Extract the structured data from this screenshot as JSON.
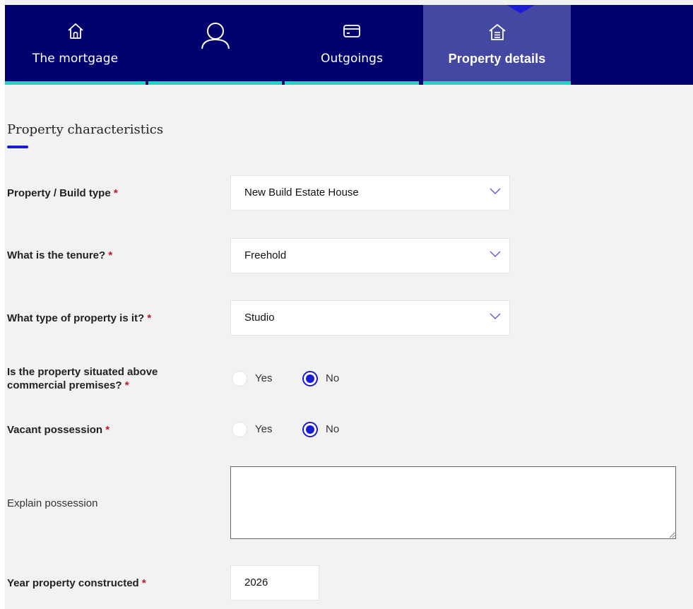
{
  "tabs": [
    {
      "id": "mortgage",
      "label": "The mortgage",
      "icon": "home-icon",
      "active": false
    },
    {
      "id": "applicant",
      "label": "",
      "icon": "person-icon",
      "active": false
    },
    {
      "id": "outgoings",
      "label": "Outgoings",
      "icon": "card-icon",
      "active": false
    },
    {
      "id": "property",
      "label": "Property details",
      "icon": "house-document-icon",
      "active": true
    }
  ],
  "colors": {
    "navy": "#02026f",
    "active_tab": "#4548a2",
    "teal_underline": "#1fd6c4",
    "accent_blue": "#1a1ad6",
    "required_red": "#c8102e",
    "page_bg": "#f2f2f2"
  },
  "section": {
    "title": "Property characteristics"
  },
  "fields": {
    "build_type": {
      "label": "Property / Build type",
      "required": "*",
      "value": "New Build Estate House"
    },
    "tenure": {
      "label": "What is the tenure?",
      "required": "*",
      "value": "Freehold"
    },
    "property_type": {
      "label": "What type of property is it?",
      "required": "*",
      "value": "Studio"
    },
    "above_commercial": {
      "label_line1": "Is the property situated above",
      "label_line2": "commercial premises?",
      "required": "*",
      "options": [
        "Yes",
        "No"
      ],
      "selected": "No"
    },
    "vacant_possession": {
      "label": "Vacant possession",
      "required": "*",
      "options": [
        "Yes",
        "No"
      ],
      "selected": "No"
    },
    "explain_possession": {
      "label": "Explain possession",
      "value": ""
    },
    "year_constructed": {
      "label": "Year property constructed",
      "required": "*",
      "value": "2026"
    }
  }
}
